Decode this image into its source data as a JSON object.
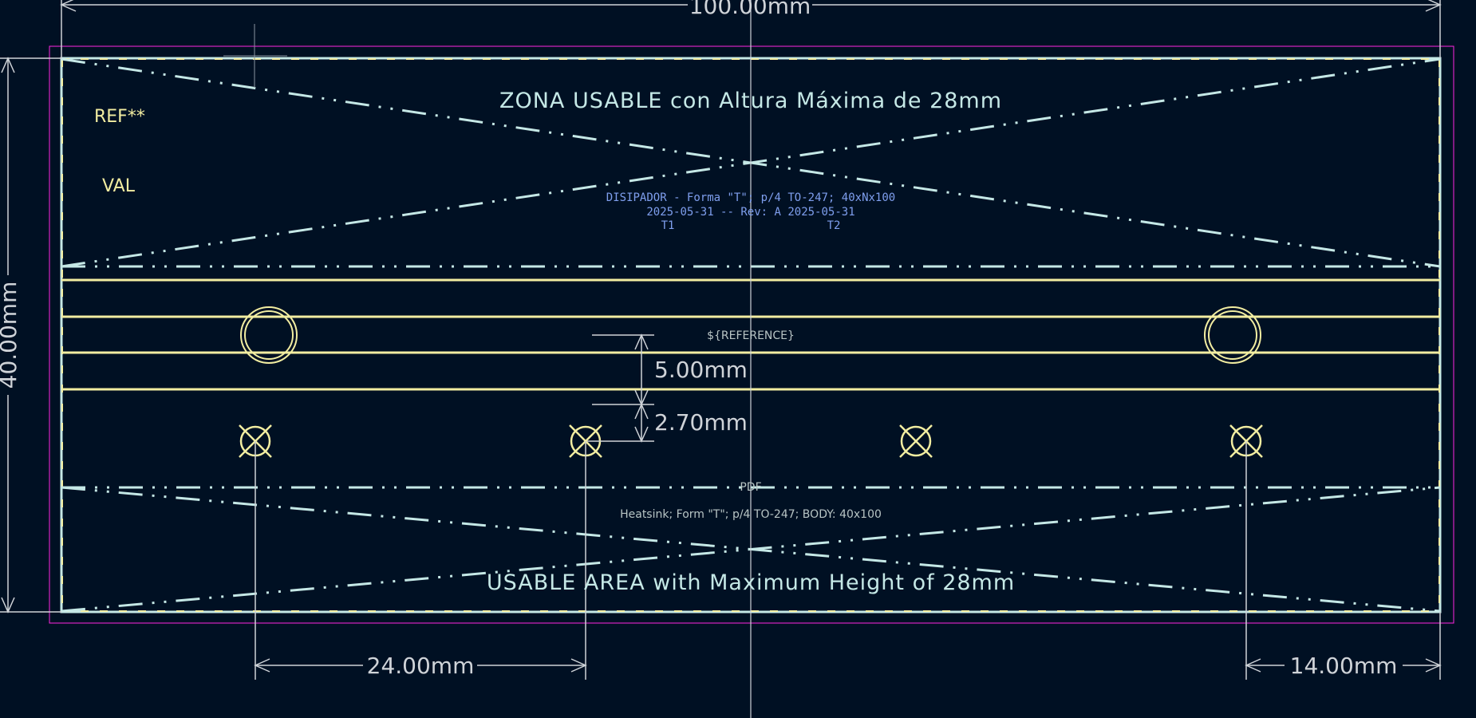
{
  "colors": {
    "background": "#001023",
    "dimension": "#cfd3d8",
    "outline": "#c5e8e6",
    "yellow": "#f2eda1",
    "courtyard": "#ff26e2",
    "fab_text": "#7f9fee"
  },
  "dimensions": {
    "width": "100.00mm",
    "height": "40.00mm",
    "slot": "5.00mm",
    "gap": "2.70mm",
    "hole_spacing": "24.00mm",
    "edge_offset": "14.00mm"
  },
  "labels": {
    "ref": "REF**",
    "val": "VAL",
    "zona_usable": "ZONA USABLE con Altura Máxima de 28mm",
    "usable_area": "USABLE AREA with Maximum Height of 28mm",
    "fab_line1": "DISIPADOR - Forma \"T\"; p/4 TO-247; 40xNx100",
    "fab_line2": "2025-05-31 -- Rev: A 2025-05-31",
    "t1": "T1",
    "t2": "T2",
    "reference_field": "${REFERENCE}",
    "pdf": "PDF",
    "heatsink_desc": "Heatsink; Form \"T\"; p/4 TO-247; BODY: 40x100"
  },
  "icons": {
    "mounting_hole": "circle-outline",
    "pad_marker": "circle-x"
  }
}
